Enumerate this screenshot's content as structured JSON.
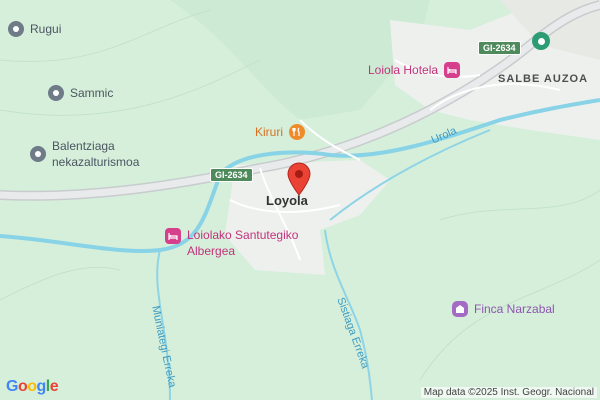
{
  "map": {
    "center_label": "Loyola",
    "district_label": "SALBE AUZOA",
    "road_shields": [
      "GI-2634",
      "GI-2634"
    ],
    "river_label": "Urola",
    "streams": [
      "Muniategi Erreka",
      "Sistiaga Erreka"
    ],
    "pois": [
      {
        "name": "Rugui",
        "icon": "pin-icon",
        "color": "#6f7b87"
      },
      {
        "name": "Sammic",
        "icon": "pin-icon",
        "color": "#6f7b87"
      },
      {
        "name": "Balentziaga\nnekazalturismoa",
        "icon": "pin-icon",
        "color": "#6f7b87"
      },
      {
        "name": "Kiruri",
        "icon": "restaurant-icon",
        "color": "#f08b2a"
      },
      {
        "name": "Loiola Hotela",
        "icon": "hotel-icon",
        "color": "#d63f8b"
      },
      {
        "name": "Loiolako Santutegiko\nAlbergea",
        "icon": "hotel-icon",
        "color": "#d63f8b"
      },
      {
        "name": "Finca Narzabal",
        "icon": "attraction-icon",
        "color": "#a46bc4"
      }
    ],
    "copyright": "Map data ©2025 Inst. Geogr. Nacional",
    "google_logo": "Google"
  }
}
